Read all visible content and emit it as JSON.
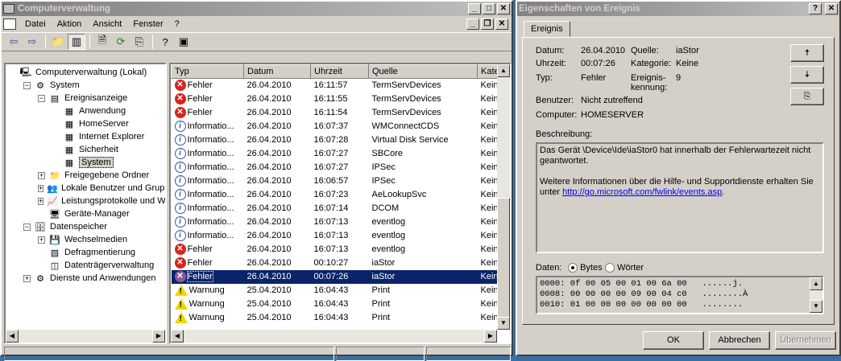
{
  "main_window": {
    "title": "Computerverwaltung",
    "menu": [
      "Datei",
      "Aktion",
      "Ansicht",
      "Fenster",
      "?"
    ],
    "tree": [
      {
        "label": "Computerverwaltung (Lokal)",
        "level": 0,
        "exp": "",
        "icon": "computer-icon"
      },
      {
        "label": "System",
        "level": 1,
        "exp": "-",
        "icon": "tools-icon"
      },
      {
        "label": "Ereignisanzeige",
        "level": 2,
        "exp": "-",
        "icon": "event-viewer-icon"
      },
      {
        "label": "Anwendung",
        "level": 3,
        "exp": "",
        "icon": "log-icon"
      },
      {
        "label": "HomeServer",
        "level": 3,
        "exp": "",
        "icon": "log-icon"
      },
      {
        "label": "Internet Explorer",
        "level": 3,
        "exp": "",
        "icon": "log-icon"
      },
      {
        "label": "Sicherheit",
        "level": 3,
        "exp": "",
        "icon": "log-icon"
      },
      {
        "label": "System",
        "level": 3,
        "exp": "",
        "icon": "log-icon",
        "selected": true
      },
      {
        "label": "Freigegebene Ordner",
        "level": 2,
        "exp": "+",
        "icon": "shared-folder-icon"
      },
      {
        "label": "Lokale Benutzer und Gruppe",
        "level": 2,
        "exp": "+",
        "icon": "users-icon"
      },
      {
        "label": "Leistungsprotokolle und Wa",
        "level": 2,
        "exp": "+",
        "icon": "performance-icon"
      },
      {
        "label": "Geräte-Manager",
        "level": 2,
        "exp": "",
        "icon": "device-manager-icon"
      },
      {
        "label": "Datenspeicher",
        "level": 1,
        "exp": "-",
        "icon": "storage-icon"
      },
      {
        "label": "Wechselmedien",
        "level": 2,
        "exp": "+",
        "icon": "removable-media-icon"
      },
      {
        "label": "Defragmentierung",
        "level": 2,
        "exp": "",
        "icon": "defrag-icon"
      },
      {
        "label": "Datenträgerverwaltung",
        "level": 2,
        "exp": "",
        "icon": "disk-management-icon"
      },
      {
        "label": "Dienste und Anwendungen",
        "level": 1,
        "exp": "+",
        "icon": "services-icon"
      }
    ],
    "columns": [
      "Typ",
      "Datum",
      "Uhrzeit",
      "Quelle",
      "Kate"
    ],
    "events": [
      {
        "type": "error",
        "typ": "Fehler",
        "datum": "26.04.2010",
        "uhrzeit": "16:11:57",
        "quelle": "TermServDevices",
        "kate": "Keine"
      },
      {
        "type": "error",
        "typ": "Fehler",
        "datum": "26.04.2010",
        "uhrzeit": "16:11:55",
        "quelle": "TermServDevices",
        "kate": "Keine"
      },
      {
        "type": "error",
        "typ": "Fehler",
        "datum": "26.04.2010",
        "uhrzeit": "16:11:54",
        "quelle": "TermServDevices",
        "kate": "Keine"
      },
      {
        "type": "info",
        "typ": "Informatio...",
        "datum": "26.04.2010",
        "uhrzeit": "16:07:37",
        "quelle": "WMConnectCDS",
        "kate": "Keine"
      },
      {
        "type": "info",
        "typ": "Informatio...",
        "datum": "26.04.2010",
        "uhrzeit": "16:07:28",
        "quelle": "Virtual Disk Service",
        "kate": "Keine"
      },
      {
        "type": "info",
        "typ": "Informatio...",
        "datum": "26.04.2010",
        "uhrzeit": "16:07:27",
        "quelle": "SBCore",
        "kate": "Keine"
      },
      {
        "type": "info",
        "typ": "Informatio...",
        "datum": "26.04.2010",
        "uhrzeit": "16:07:27",
        "quelle": "IPSec",
        "kate": "Keine"
      },
      {
        "type": "info",
        "typ": "Informatio...",
        "datum": "26.04.2010",
        "uhrzeit": "16:06:57",
        "quelle": "IPSec",
        "kate": "Keine"
      },
      {
        "type": "info",
        "typ": "Informatio...",
        "datum": "26.04.2010",
        "uhrzeit": "16:07:23",
        "quelle": "AeLookupSvc",
        "kate": "Keine"
      },
      {
        "type": "info",
        "typ": "Informatio...",
        "datum": "26.04.2010",
        "uhrzeit": "16:07:14",
        "quelle": "DCOM",
        "kate": "Keine"
      },
      {
        "type": "info",
        "typ": "Informatio...",
        "datum": "26.04.2010",
        "uhrzeit": "16:07:13",
        "quelle": "eventlog",
        "kate": "Keine"
      },
      {
        "type": "info",
        "typ": "Informatio...",
        "datum": "26.04.2010",
        "uhrzeit": "16:07:13",
        "quelle": "eventlog",
        "kate": "Keine"
      },
      {
        "type": "error",
        "typ": "Fehler",
        "datum": "26.04.2010",
        "uhrzeit": "16:07:13",
        "quelle": "eventlog",
        "kate": "Keine"
      },
      {
        "type": "error",
        "typ": "Fehler",
        "datum": "26.04.2010",
        "uhrzeit": "00:10:27",
        "quelle": "iaStor",
        "kate": "Keine"
      },
      {
        "type": "error",
        "typ": "Fehler",
        "datum": "26.04.2010",
        "uhrzeit": "00:07:26",
        "quelle": "iaStor",
        "kate": "Keine",
        "selected": true
      },
      {
        "type": "warn",
        "typ": "Warnung",
        "datum": "25.04.2010",
        "uhrzeit": "16:04:43",
        "quelle": "Print",
        "kate": "Keine"
      },
      {
        "type": "warn",
        "typ": "Warnung",
        "datum": "25.04.2010",
        "uhrzeit": "16:04:43",
        "quelle": "Print",
        "kate": "Keine"
      },
      {
        "type": "warn",
        "typ": "Warnung",
        "datum": "25.04.2010",
        "uhrzeit": "16:04:43",
        "quelle": "Print",
        "kate": "Keine"
      }
    ]
  },
  "dialog": {
    "title": "Eigenschaften von Ereignis",
    "tab": "Ereignis",
    "datum_label": "Datum:",
    "datum": "26.04.2010",
    "quelle_label": "Quelle:",
    "quelle": "iaStor",
    "uhrzeit_label": "Uhrzeit:",
    "uhrzeit": "00:07:26",
    "kategorie_label": "Kategorie:",
    "kategorie": "Keine",
    "typ_label": "Typ:",
    "typ": "Fehler",
    "kennung_label_1": "Ereignis-",
    "kennung_label_2": "kennung:",
    "kennung": "9",
    "benutzer_label": "Benutzer:",
    "benutzer": "Nicht zutreffend",
    "computer_label": "Computer:",
    "computer": "HOMESERVER",
    "beschreibung_label": "Beschreibung:",
    "beschreibung_1": "Das Gerät \\Device\\Ide\\iaStor0 hat innerhalb der Fehlerwartezeit nicht geantwortet.",
    "beschreibung_2": "Weitere Informationen über die Hilfe- und Supportdienste erhalten Sie unter ",
    "link": "http://go.microsoft.com/fwlink/events.asp",
    "link_suffix": ".",
    "daten_label": "Daten:",
    "bytes_label": "Bytes",
    "woerter_label": "Wörter",
    "hex_lines": [
      "0000: 0f 00 05 00 01 00 6a 00   ......j.",
      "0008: 00 00 00 00 09 00 04 c0   ........À",
      "0010: 01 00 00 00 00 00 00 00   ........"
    ],
    "ok": "OK",
    "cancel": "Abbrechen",
    "apply": "Übernehmen"
  }
}
